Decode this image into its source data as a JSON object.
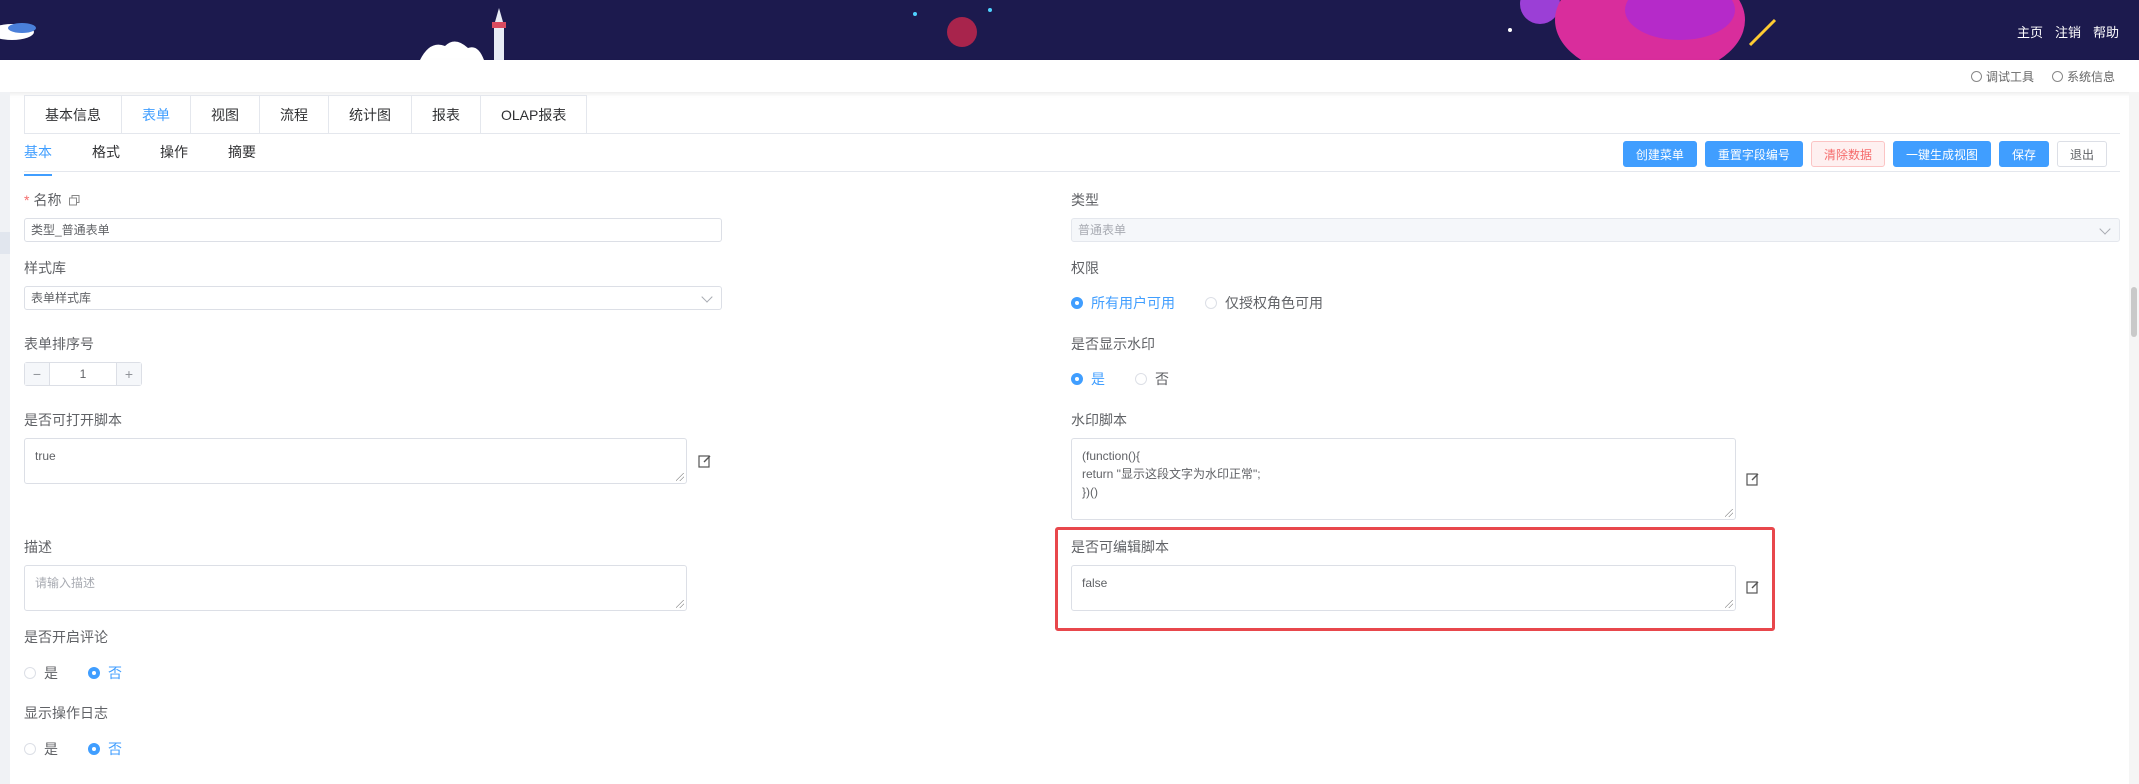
{
  "header": {
    "links": [
      "主页",
      "注销",
      "帮助"
    ],
    "tools": [
      "调试工具",
      "系统信息"
    ]
  },
  "main_tabs": [
    {
      "label": "基本信息",
      "active": false
    },
    {
      "label": "表单",
      "active": true
    },
    {
      "label": "视图",
      "active": false
    },
    {
      "label": "流程",
      "active": false
    },
    {
      "label": "统计图",
      "active": false
    },
    {
      "label": "报表",
      "active": false
    },
    {
      "label": "OLAP报表",
      "active": false
    }
  ],
  "sub_tabs": [
    {
      "label": "基本",
      "active": true
    },
    {
      "label": "格式",
      "active": false
    },
    {
      "label": "操作",
      "active": false
    },
    {
      "label": "摘要",
      "active": false
    }
  ],
  "actions": {
    "create_menu": "创建菜单",
    "reset_field_no": "重置字段编号",
    "clear_data": "清除数据",
    "generate_view": "一键生成视图",
    "save": "保存",
    "exit": "退出"
  },
  "form": {
    "name": {
      "label": "名称",
      "value": "类型_普通表单"
    },
    "type": {
      "label": "类型",
      "value": "普通表单"
    },
    "style_lib": {
      "label": "样式库",
      "value": "表单样式库"
    },
    "permission": {
      "label": "权限",
      "options": [
        "所有用户可用",
        "仅授权角色可用"
      ],
      "selected": "所有用户可用"
    },
    "sort_no": {
      "label": "表单排序号",
      "value": "1"
    },
    "watermark_show": {
      "label": "是否显示水印",
      "options": [
        "是",
        "否"
      ],
      "selected": "是"
    },
    "open_script": {
      "label": "是否可打开脚本",
      "value": "true"
    },
    "watermark_script": {
      "label": "水印脚本",
      "value": "(function(){\nreturn \"显示这段文字为水印正常\";\n})()"
    },
    "description": {
      "label": "描述",
      "placeholder": "请输入描述"
    },
    "edit_script": {
      "label": "是否可编辑脚本",
      "value": "false"
    },
    "comment": {
      "label": "是否开启评论",
      "options": [
        "是",
        "否"
      ],
      "selected": "否"
    },
    "op_log": {
      "label": "显示操作日志",
      "options": [
        "是",
        "否"
      ],
      "selected": "否"
    }
  }
}
